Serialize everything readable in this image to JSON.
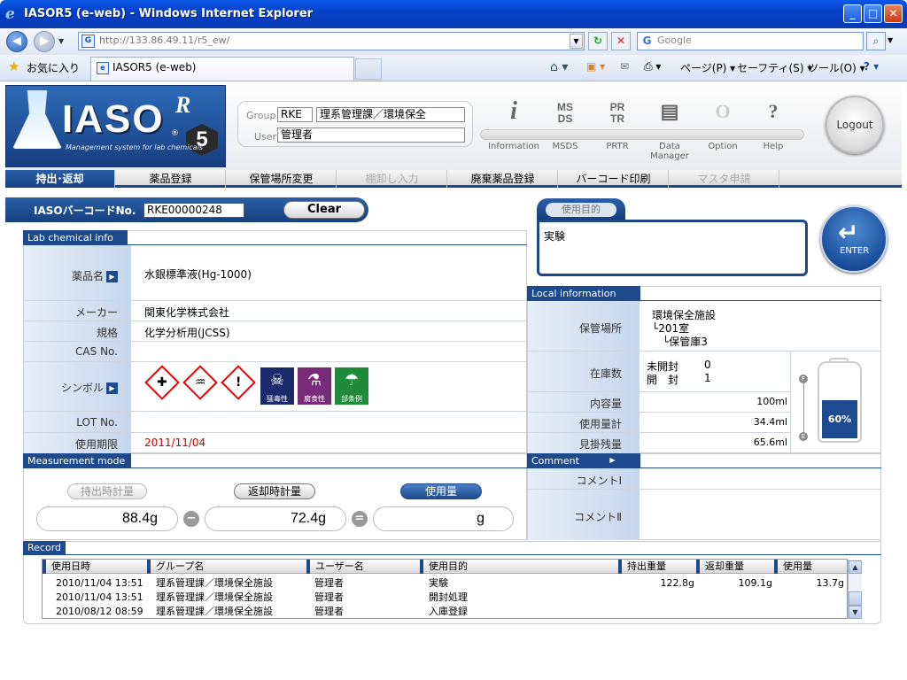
{
  "window": {
    "title": "IASOR5 (e-web) - Windows Internet Explorer",
    "ie_icon": "e",
    "min": "_",
    "max": "□",
    "close": "✕"
  },
  "browser": {
    "back": "◀",
    "forward": "▶",
    "nav_drop": "▼",
    "url": "http://133.86.49.11/r5_ew/",
    "url_drop": "▼",
    "refresh": "↻",
    "stop": "✕",
    "search_placeholder": "Google",
    "search_g": "G",
    "search_btn": "⌕",
    "search_drop": "▼",
    "favorites_label": "お気に入り",
    "tab_title": "IASOR5 (e-web)",
    "cmd": {
      "home": "⌂ ▾",
      "feeds": "▣ ▾",
      "mail": "✉",
      "print": "⎙ ▾",
      "page": "ページ(P) ▾",
      "safety": "セーフティ(S) ▾",
      "tools": "ツール(O) ▾",
      "help": "? ▾"
    }
  },
  "header": {
    "logo_text": "IASO",
    "logo_r": "R",
    "logo_num": "5",
    "logo_sub": "Management system for lab chemicals",
    "logo_reg": "®",
    "group_label": "Group",
    "user_label": "User",
    "group_code": "RKE",
    "group_name": "理系管理課／環境保全",
    "user_name": "管理者",
    "buttons": [
      {
        "icon": "i",
        "label": "Information"
      },
      {
        "icon": "MS\nDS",
        "label": "MSDS"
      },
      {
        "icon": "PR\nTR",
        "label": "PRTR"
      },
      {
        "icon": "▤",
        "label": "Data Manager"
      },
      {
        "icon": "O",
        "label": "Option"
      },
      {
        "icon": "?",
        "label": "Help"
      }
    ],
    "logout": "Logout"
  },
  "nav_tabs": [
    "持出･返却",
    "薬品登録",
    "保管場所変更",
    "棚卸し入力",
    "廃棄薬品登録",
    "バーコード印刷",
    "マスタ申請"
  ],
  "barcode": {
    "label": "IASOバーコードNo.",
    "value": "RKE00000248",
    "clear": "Clear"
  },
  "purpose": {
    "tab": "使用目的",
    "text": "実験"
  },
  "enter": {
    "arrow": "↵",
    "label": "ENTER"
  },
  "chem": {
    "title": "Lab chemical info",
    "labels": {
      "name": "薬品名",
      "maker": "メーカー",
      "grade": "規格",
      "cas": "CAS No.",
      "symbol": "シンボル",
      "lot": "LOT No.",
      "expiry": "使用期限"
    },
    "values": {
      "name": "水銀標準液(Hg-1000)",
      "maker": "関東化学株式会社",
      "grade": "化学分析用(JCSS)",
      "cas": "",
      "lot": "",
      "expiry": "2011/11/04"
    },
    "arrow": "▶",
    "ghs": {
      "health": "✚",
      "env": "♒",
      "excl": "!"
    },
    "ghs_labels": {
      "toxic": "猛毒性",
      "corrosive": "腐食性",
      "plant": "部条例"
    },
    "ghs_icons": {
      "toxic": "☠",
      "corrosive": "⚗",
      "plant": "☂"
    }
  },
  "local": {
    "title": "Local information",
    "labels": {
      "location": "保管場所",
      "stock": "在庫数",
      "content": "内容量",
      "usage_total": "使用量計",
      "remaining": "見掛残量"
    },
    "location": [
      "環境保全施設",
      "└201室",
      "　└保管庫3"
    ],
    "stock": {
      "unopened_label": "未開封",
      "unopened": "0",
      "opened_label": "開　封",
      "opened": "1"
    },
    "content": "100ml",
    "usage_total": "34.4ml",
    "remaining": "65.6ml",
    "bottle_percent": "60%",
    "gauge_f": "F",
    "gauge_e": "E"
  },
  "measure": {
    "title": "Measurement mode",
    "labels": [
      "持出時計量",
      "返却時計量",
      "使用量"
    ],
    "values": [
      "88.4g",
      "72.4g",
      "g"
    ],
    "minus": "−",
    "equals": "="
  },
  "comment": {
    "title": "Comment",
    "arrow": "▶",
    "label1": "コメントⅠ",
    "label2": "コメントⅡ"
  },
  "record": {
    "title": "Record",
    "columns": [
      "使用日時",
      "グループ名",
      "ユーザー名",
      "使用目的",
      "持出重量",
      "返却重量",
      "使用量"
    ],
    "rows": [
      [
        "2010/11/04 13:51",
        "理系管理課／環境保全施設",
        "管理者",
        "実験",
        "122.8g",
        "109.1g",
        "13.7g"
      ],
      [
        "2010/11/04 13:51",
        "理系管理課／環境保全施設",
        "管理者",
        "開封処理",
        "",
        "",
        ""
      ],
      [
        "2010/08/12 08:59",
        "理系管理課／環境保全施設",
        "管理者",
        "入庫登録",
        "",
        "",
        ""
      ]
    ],
    "scroll_up": "▲",
    "scroll_down": "▼"
  }
}
